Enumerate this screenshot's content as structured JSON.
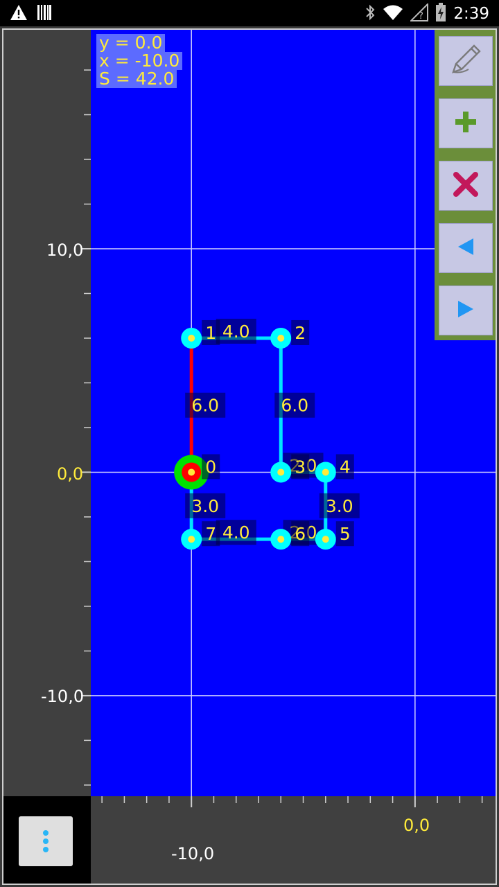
{
  "status_bar": {
    "time": "2:39",
    "left_icons": [
      "warning-icon",
      "barcode-icon"
    ],
    "right_icons": [
      "bluetooth-icon",
      "wifi-icon",
      "signal-icon",
      "battery-charging-icon"
    ]
  },
  "info": {
    "y": "y = 0.0",
    "x": "x = -10.0",
    "s": "S = 42.0"
  },
  "axes": {
    "y_label_10": "10,0",
    "y_label_0": "0,0",
    "y_label_m10": "-10,0",
    "x_label_0": "0,0",
    "x_label_m10": "-10,0"
  },
  "toolbar": {
    "buttons": [
      "pencil-icon",
      "plus-icon",
      "cross-icon",
      "arrow-left-icon",
      "arrow-right-icon"
    ]
  },
  "colors": {
    "plot_bg": "#0000ff",
    "grid": "#d0d0ff",
    "edge": "#00e5ff",
    "selected_edge": "#ff0000",
    "vertex": "#00ffff",
    "vertex_center": "#ffeb3b",
    "label_text": "#ffeb3b",
    "toolbar_bg": "#6b8e3a"
  },
  "chart_data": {
    "type": "scatter",
    "points": [
      {
        "id": "0",
        "x": -10,
        "y": 0
      },
      {
        "id": "1",
        "x": -10,
        "y": 6
      },
      {
        "id": "2",
        "x": -6,
        "y": 6
      },
      {
        "id": "3",
        "x": -6,
        "y": 0
      },
      {
        "id": "4",
        "x": -4,
        "y": 0
      },
      {
        "id": "5",
        "x": -4,
        "y": -3
      },
      {
        "id": "6",
        "x": -6,
        "y": -3
      },
      {
        "id": "7",
        "x": -10,
        "y": -3
      }
    ],
    "edges": [
      {
        "from": 0,
        "to": 1,
        "length": "6.0",
        "selected": true
      },
      {
        "from": 1,
        "to": 2,
        "length": "4.0"
      },
      {
        "from": 2,
        "to": 3,
        "length": "6.0"
      },
      {
        "from": 3,
        "to": 4,
        "length": "2.0"
      },
      {
        "from": 4,
        "to": 5,
        "length": "3.0"
      },
      {
        "from": 5,
        "to": 6,
        "length": "2.0"
      },
      {
        "from": 6,
        "to": 7,
        "length": "4.0"
      },
      {
        "from": 7,
        "to": 0,
        "length": "3.0"
      }
    ],
    "selected_point": 0,
    "xlim": [
      -14.5,
      3.6
    ],
    "ylim": [
      -14.5,
      19.8
    ],
    "grid": true,
    "grid_x": [
      -10,
      0
    ],
    "grid_y": [
      -10,
      0,
      10
    ]
  }
}
